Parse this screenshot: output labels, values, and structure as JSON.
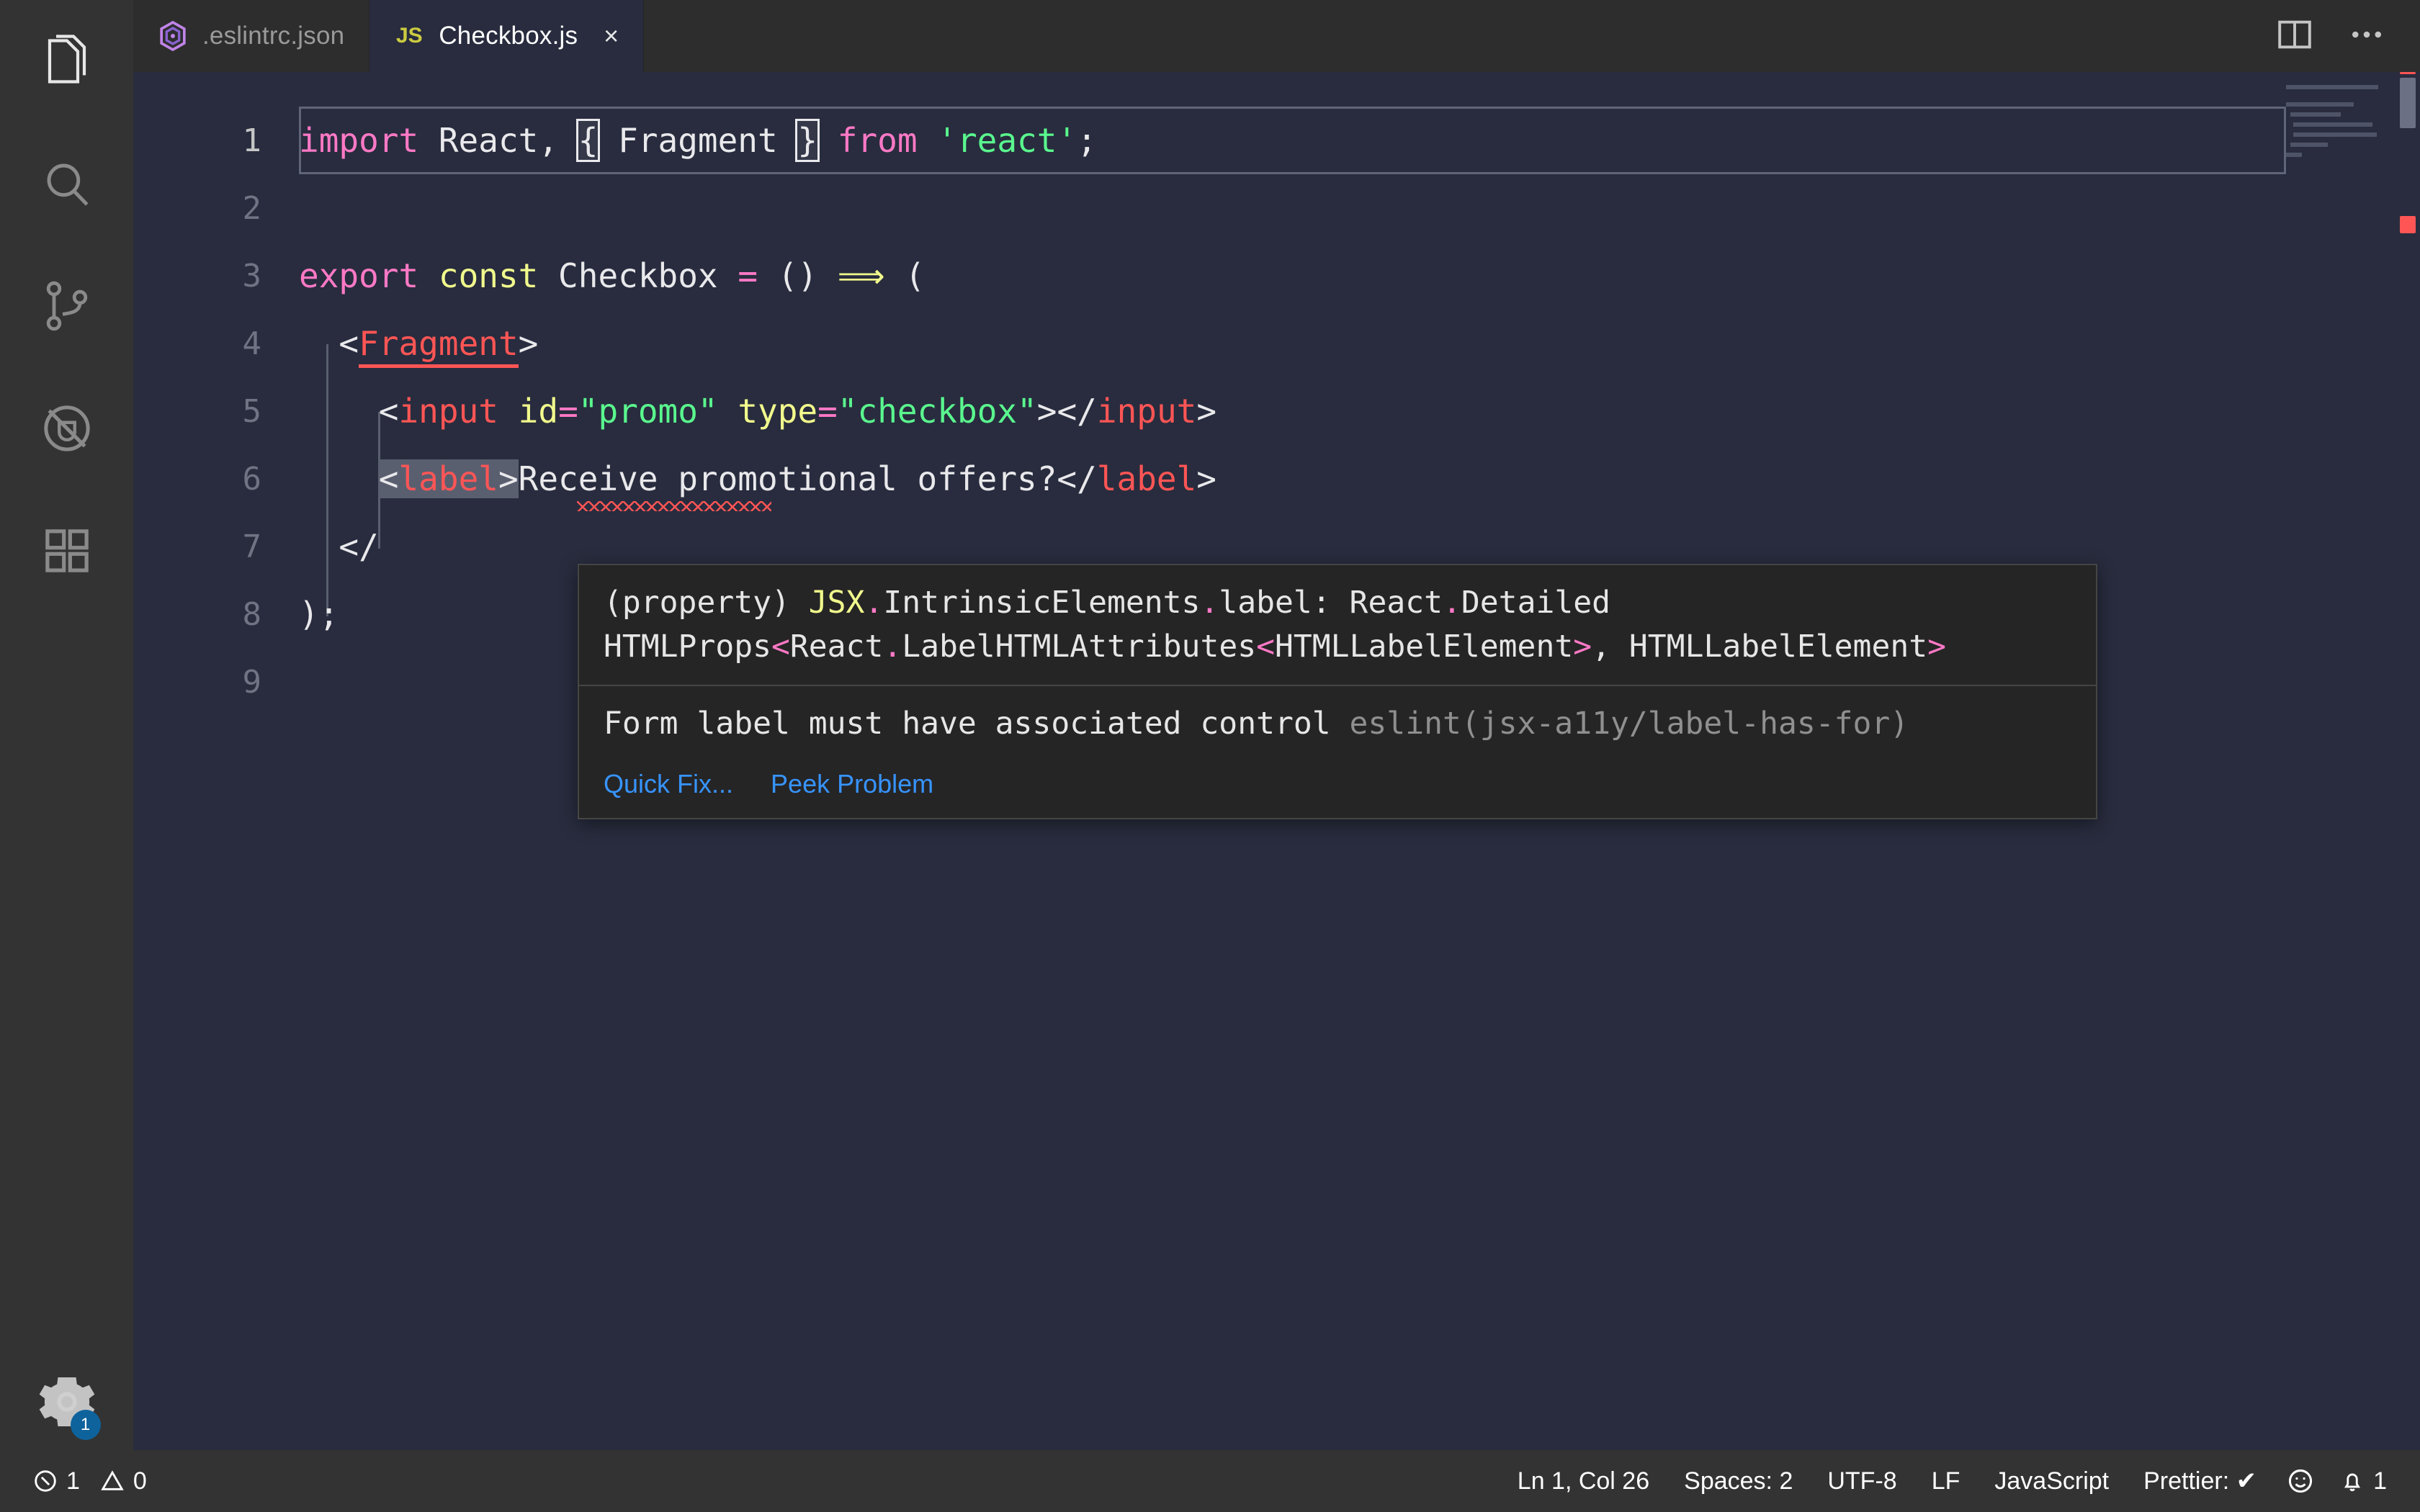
{
  "window": {
    "theme_bg": "#282c3e",
    "accent": "#0e639c"
  },
  "activity_bar": {
    "items": [
      {
        "name": "explorer",
        "icon": "files-icon",
        "active": true
      },
      {
        "name": "search",
        "icon": "search-icon",
        "active": false
      },
      {
        "name": "source-control",
        "icon": "source-control-icon",
        "active": false
      },
      {
        "name": "run-and-debug",
        "icon": "debug-disabled-icon",
        "active": false
      },
      {
        "name": "extensions",
        "icon": "extensions-icon",
        "active": false
      }
    ],
    "settings": {
      "icon": "gear-icon",
      "badge": "1"
    }
  },
  "tabs": [
    {
      "label": ".eslintrc.json",
      "icon": "eslint-icon",
      "active": false,
      "closable": false
    },
    {
      "label": "Checkbox.js",
      "icon": "js-icon",
      "icon_text": "JS",
      "active": true,
      "closable": true,
      "close_glyph": "×"
    }
  ],
  "tabbar_actions": [
    {
      "name": "split-editor",
      "icon": "split-editor-icon"
    },
    {
      "name": "more-actions",
      "icon": "ellipsis-icon",
      "glyph": "⋯"
    }
  ],
  "editor": {
    "language": "JavaScript",
    "lines": [
      {
        "number": "1",
        "text": "import React, { Fragment } from 'react';"
      },
      {
        "number": "2",
        "text": ""
      },
      {
        "number": "3",
        "text": "export const Checkbox = () => ("
      },
      {
        "number": "4",
        "text": "  <Fragment>"
      },
      {
        "number": "5",
        "text": "    <input id=\"promo\" type=\"checkbox\"></input>"
      },
      {
        "number": "6",
        "text": "    <label>Receive promotional offers?</label>"
      },
      {
        "number": "7",
        "text": "  </Fragment>"
      },
      {
        "number": "8",
        "text": ");"
      },
      {
        "number": "9",
        "text": ""
      }
    ],
    "tokens": {
      "l1": [
        {
          "t": "import",
          "c": "t-kw"
        },
        {
          "t": " React, ",
          "c": "t-plain"
        },
        {
          "t": "{",
          "c": "t-plain bracket-match"
        },
        {
          "t": " Fragment ",
          "c": "t-plain"
        },
        {
          "t": "}",
          "c": "t-plain bracket-match"
        },
        {
          "t": " ",
          "c": "t-plain"
        },
        {
          "t": "from",
          "c": "t-kw"
        },
        {
          "t": " ",
          "c": "t-plain"
        },
        {
          "t": "'react'",
          "c": "t-str"
        },
        {
          "t": ";",
          "c": "t-plain"
        }
      ],
      "l3": [
        {
          "t": "export",
          "c": "t-kw"
        },
        {
          "t": " ",
          "c": "t-plain"
        },
        {
          "t": "const",
          "c": "t-const"
        },
        {
          "t": " Checkbox ",
          "c": "t-plain"
        },
        {
          "t": "=",
          "c": "t-op"
        },
        {
          "t": " () ",
          "c": "t-plain"
        },
        {
          "t": "⟹",
          "c": "t-arrow"
        },
        {
          "t": " (",
          "c": "t-plain"
        }
      ],
      "l4": [
        {
          "t": "  <",
          "c": "t-plain"
        },
        {
          "t": "Fragment",
          "c": "t-tag err-underline-solid"
        },
        {
          "t": ">",
          "c": "t-plain"
        }
      ],
      "l5": [
        {
          "t": "    <",
          "c": "t-plain"
        },
        {
          "t": "input",
          "c": "t-tag"
        },
        {
          "t": " ",
          "c": "t-plain"
        },
        {
          "t": "id",
          "c": "t-attr"
        },
        {
          "t": "=",
          "c": "t-op"
        },
        {
          "t": "\"promo\"",
          "c": "t-str"
        },
        {
          "t": " ",
          "c": "t-plain"
        },
        {
          "t": "type",
          "c": "t-attr"
        },
        {
          "t": "=",
          "c": "t-op"
        },
        {
          "t": "\"checkbox\"",
          "c": "t-str"
        },
        {
          "t": "></",
          "c": "t-plain"
        },
        {
          "t": "input",
          "c": "t-tag"
        },
        {
          "t": ">",
          "c": "t-plain"
        }
      ],
      "l6_pre": "    ",
      "l6_hl": [
        {
          "t": "<",
          "c": "t-plain"
        },
        {
          "t": "label",
          "c": "t-tag"
        },
        {
          "t": ">",
          "c": "t-plain"
        }
      ],
      "l6_post": [
        {
          "t": "Receive promotional offers?</",
          "c": "t-plain"
        },
        {
          "t": "label",
          "c": "t-tag"
        },
        {
          "t": ">",
          "c": "t-plain"
        }
      ],
      "l7": [
        {
          "t": "  </",
          "c": "t-plain"
        }
      ],
      "l8": [
        {
          "t": ");",
          "c": "t-plain"
        }
      ]
    }
  },
  "hover": {
    "signature_parts": [
      {
        "t": "(property) ",
        "c": ""
      },
      {
        "t": "JSX",
        "c": "t-ty"
      },
      {
        "t": ".",
        "c": "t-dot"
      },
      {
        "t": "IntrinsicElements",
        "c": ""
      },
      {
        "t": ".",
        "c": "t-dot"
      },
      {
        "t": "label: React",
        "c": ""
      },
      {
        "t": ".",
        "c": "t-dot"
      },
      {
        "t": "Detailed HTMLProps",
        "c": ""
      },
      {
        "t": "<",
        "c": "t-ang"
      },
      {
        "t": "React",
        "c": ""
      },
      {
        "t": ".",
        "c": "t-dot"
      },
      {
        "t": "LabelHTMLAttributes",
        "c": ""
      },
      {
        "t": "<",
        "c": "t-ang"
      },
      {
        "t": "HTMLLabelElement",
        "c": ""
      },
      {
        "t": ">",
        "c": "t-ang"
      },
      {
        "t": ", HTMLLabelElement",
        "c": ""
      },
      {
        "t": ">",
        "c": "t-ang"
      }
    ],
    "message": "Form label must have associated control ",
    "source": "eslint(jsx-a11y/label-has-for)",
    "actions": [
      {
        "label": "Quick Fix...",
        "name": "quick-fix-link"
      },
      {
        "label": "Peek Problem",
        "name": "peek-problem-link"
      }
    ]
  },
  "status_bar": {
    "left": [
      {
        "name": "errors",
        "icon": "error-circle-icon",
        "value": "1"
      },
      {
        "name": "warnings",
        "icon": "warning-triangle-icon",
        "value": "0"
      }
    ],
    "right": [
      {
        "name": "cursor-position",
        "label": "Ln 1, Col 26"
      },
      {
        "name": "indentation",
        "label": "Spaces: 2"
      },
      {
        "name": "encoding",
        "label": "UTF-8"
      },
      {
        "name": "eol",
        "label": "LF"
      },
      {
        "name": "language-mode",
        "label": "JavaScript"
      },
      {
        "name": "prettier",
        "label": "Prettier: ✔"
      },
      {
        "name": "feedback",
        "icon": "smiley-icon",
        "label": ""
      },
      {
        "name": "notifications",
        "icon": "bell-icon",
        "label": "1"
      }
    ]
  }
}
